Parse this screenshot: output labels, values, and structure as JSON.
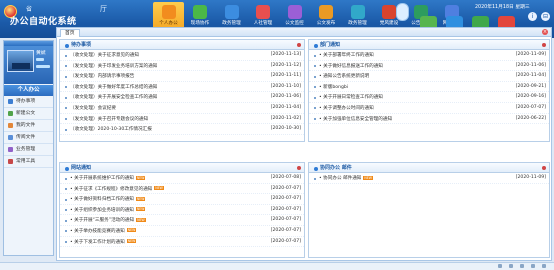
{
  "header": {
    "logo_sub": "省",
    "logo_dept": "厅",
    "logo_title": "办公自动化系统",
    "date": "2020年11月18日 星期三",
    "win_buttons": [
      "i",
      "⊟"
    ]
  },
  "topnav": [
    {
      "label": "个人办公",
      "color": "#f28c1e",
      "active": true
    },
    {
      "label": "现场协作",
      "color": "#4bb848",
      "active": false
    },
    {
      "label": "政务管理",
      "color": "#3c8de0",
      "active": false
    },
    {
      "label": "人社管理",
      "color": "#e84f4f",
      "active": false
    },
    {
      "label": "公文监控",
      "color": "#9b5fd6",
      "active": false
    },
    {
      "label": "公文发布",
      "color": "#ea9a24",
      "active": false
    },
    {
      "label": "政务管理",
      "color": "#31a8c9",
      "active": false
    },
    {
      "label": "党风建设",
      "color": "#d9442e",
      "active": false
    },
    {
      "label": "公告信息",
      "color": "#2d9c5f",
      "active": false
    },
    {
      "label": "网络首页",
      "color": "#4f7fe0",
      "active": false
    }
  ],
  "quick": [
    {
      "label": "系统管理",
      "color": "#57b54f"
    },
    {
      "label": "组织管理",
      "color": "#2f8fe0"
    },
    {
      "label": "签名",
      "color": "#40a84a"
    },
    {
      "label": "人事管理",
      "color": "#e2463c"
    }
  ],
  "sidebar": {
    "user_name": "黄斌",
    "section_title": "个人办公",
    "items": [
      {
        "label": "待办事项",
        "color": "#3d7ed2"
      },
      {
        "label": "新建公文",
        "color": "#52a34a"
      },
      {
        "label": "我的文件",
        "color": "#e2873a"
      },
      {
        "label": "传阅文件",
        "color": "#5a8fd8"
      },
      {
        "label": "业务管理",
        "color": "#9262c9"
      },
      {
        "label": "常用工具",
        "color": "#c74848"
      }
    ]
  },
  "main": {
    "tab_label": "首页",
    "tab_close": "×"
  },
  "panels": {
    "todo": {
      "title": "待办事项",
      "rows": [
        {
          "text": "（收文处理）关于征求意见的通知",
          "date": "[2020-11-13]"
        },
        {
          "text": "（发文处理）关于印发业务培训方案的通知",
          "date": "[2020-11-12]"
        },
        {
          "text": "（发文处理）内部请示事项报告",
          "date": "[2020-11-11]"
        },
        {
          "text": "（收文处理）关于做好年度工作总结的通知",
          "date": "[2020-11-10]"
        },
        {
          "text": "（收文处理）关于开展安全检查工作的通知",
          "date": "[2020-11-06]"
        },
        {
          "text": "（发文处理）会议纪要",
          "date": "[2020-11-04]"
        },
        {
          "text": "（发文处理）关于召开专题会议的通知",
          "date": "[2020-11-02]"
        },
        {
          "text": "（收文处理）2020-10-30工作情况汇报",
          "date": "[2020-10-30]"
        }
      ]
    },
    "notice": {
      "title": "部门通知",
      "rows": [
        {
          "text": "• 关于部署年终工作的通知",
          "date": "[2020-11-09]"
        },
        {
          "text": "• 关于做好信息报送工作的通知",
          "date": "[2020-11-06]"
        },
        {
          "text": "• 通知公告系统更新说明",
          "date": "[2020-11-04]"
        },
        {
          "text": "• 新版bongbi",
          "date": "[2020-09-21]"
        },
        {
          "text": "• 关于开展日常检查工作的通知",
          "date": "[2020-09-16]"
        },
        {
          "text": "• 关于调整办公时间的通知",
          "date": "[2020-07-07]"
        },
        {
          "text": "• 关于加强单位信息安全管理的通知",
          "date": "[2020-06-22]"
        }
      ]
    },
    "announce": {
      "title": "网站通知",
      "rows": [
        {
          "text": "• 关于开展系统维护工作的通知",
          "date": "[2020-07-08]",
          "isnew": true
        },
        {
          "text": "• 关于征求《工作规程》修改意见的通知",
          "date": "[2020-07-07]",
          "isnew": true
        },
        {
          "text": "• 关于做好资料归档工作的通知",
          "date": "[2020-07-07]",
          "isnew": true
        },
        {
          "text": "• 关于组织参加业务培训的通知",
          "date": "[2020-07-07]",
          "isnew": true
        },
        {
          "text": "• 关于开展“三服务”活动的通知",
          "date": "[2020-07-07]",
          "isnew": true
        },
        {
          "text": "• 关于举办技能竞赛的通知",
          "date": "[2020-07-07]",
          "isnew": true
        },
        {
          "text": "• 关于下发工作计划的通知",
          "date": "[2020-07-07]",
          "isnew": true
        }
      ]
    },
    "collab": {
      "title": "协同办公 邮件",
      "rows": [
        {
          "text": "• 协同办公 邮件通知",
          "date": "[2020-11-09]",
          "isnew": true
        }
      ]
    }
  },
  "status": {
    "icons": [
      "refresh-icon",
      "sound-icon",
      "print-icon",
      "folder-icon",
      "settings-icon"
    ]
  }
}
